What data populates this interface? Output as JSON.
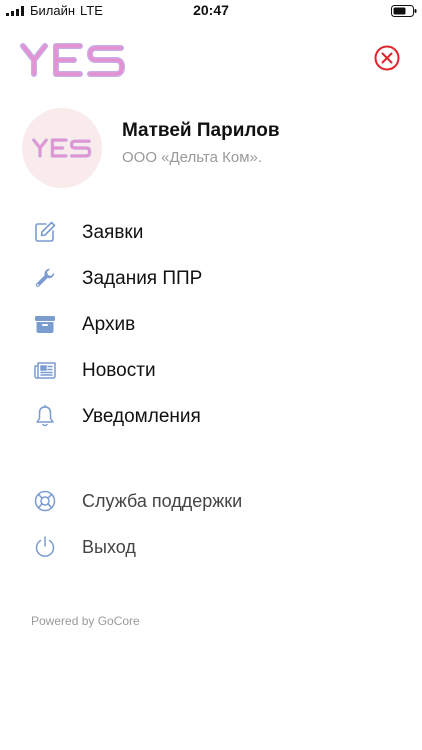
{
  "status_bar": {
    "carrier": "Билайн",
    "network": "LTE",
    "time": "20:47"
  },
  "header": {
    "logo_text": "YES",
    "close_icon": "close-circle-icon",
    "accent_color": "#e0242c",
    "logo_color": "#d87ac0"
  },
  "profile": {
    "name": "Матвей Парилов",
    "company": "ООО «Дельта Ком».",
    "avatar_text": "YES"
  },
  "menu": {
    "items": [
      {
        "label": "Заявки",
        "icon": "edit-icon"
      },
      {
        "label": "Задания ППР",
        "icon": "wrench-icon"
      },
      {
        "label": "Архив",
        "icon": "archive-icon"
      },
      {
        "label": "Новости",
        "icon": "newspaper-icon"
      },
      {
        "label": "Уведомления",
        "icon": "bell-icon"
      }
    ],
    "secondary": [
      {
        "label": "Служба поддержки",
        "icon": "lifebuoy-icon"
      },
      {
        "label": "Выход",
        "icon": "power-icon"
      }
    ]
  },
  "footer": {
    "powered": "Powered by GoCore"
  }
}
